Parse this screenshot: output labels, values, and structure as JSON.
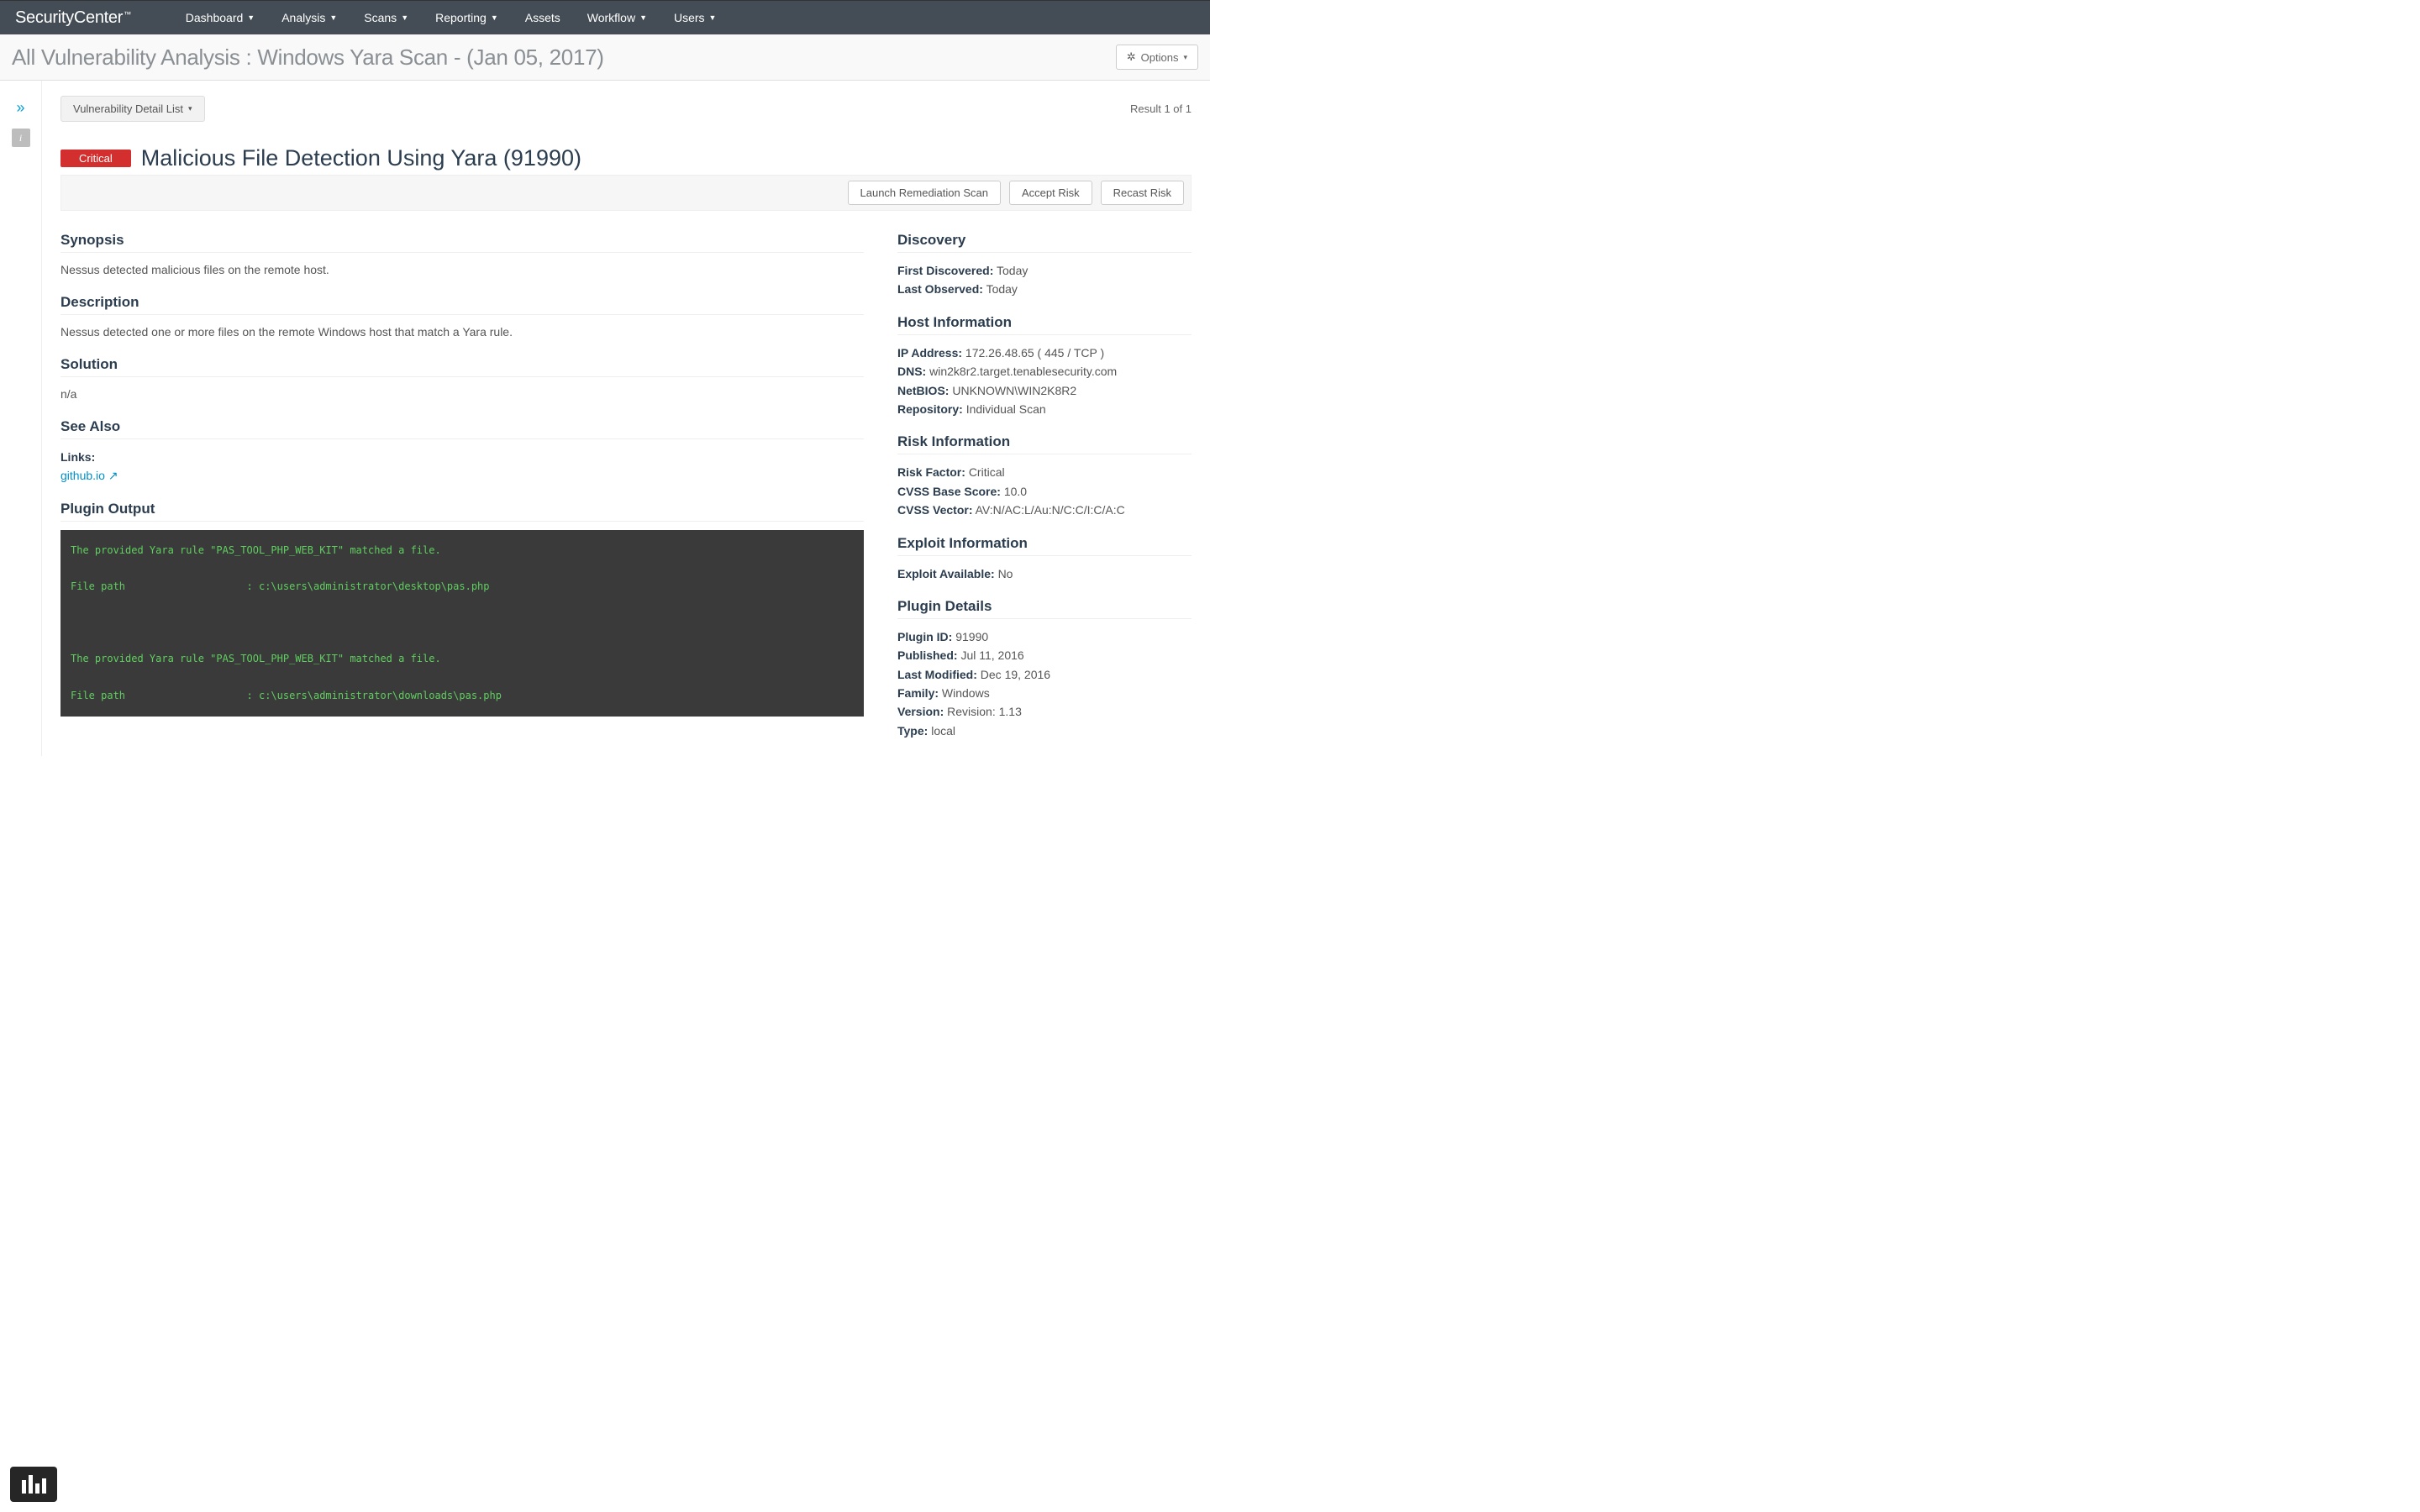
{
  "brand": "SecurityCenter",
  "nav": [
    "Dashboard",
    "Analysis",
    "Scans",
    "Reporting",
    "Assets",
    "Workflow",
    "Users"
  ],
  "nav_no_caret": [
    "Assets"
  ],
  "page_title": "All Vulnerability Analysis : Windows Yara Scan - (Jan 05, 2017)",
  "options_label": "Options",
  "view_selector": "Vulnerability Detail List",
  "result_count": "Result 1 of 1",
  "severity": "Critical",
  "vuln_title": "Malicious File Detection Using Yara (91990)",
  "actions": {
    "launch": "Launch Remediation Scan",
    "accept": "Accept Risk",
    "recast": "Recast Risk"
  },
  "left": {
    "synopsis_h": "Synopsis",
    "synopsis": "Nessus detected malicious files on the remote host.",
    "description_h": "Description",
    "description": "Nessus detected one or more files on the remote Windows host that match a Yara rule.",
    "solution_h": "Solution",
    "solution": "n/a",
    "seealso_h": "See Also",
    "links_label": "Links:",
    "link_text": "github.io",
    "plugin_output_h": "Plugin Output",
    "plugin_output": "The provided Yara rule \"PAS_TOOL_PHP_WEB_KIT\" matched a file.\n\nFile path                    : c:\\users\\administrator\\desktop\\pas.php\n\n\n\nThe provided Yara rule \"PAS_TOOL_PHP_WEB_KIT\" matched a file.\n\nFile path                    : c:\\users\\administrator\\downloads\\pas.php"
  },
  "right": {
    "discovery_h": "Discovery",
    "discovery": {
      "first_label": "First Discovered:",
      "first_val": "Today",
      "last_label": "Last Observed:",
      "last_val": "Today"
    },
    "host_h": "Host Information",
    "host": {
      "ip_label": "IP Address:",
      "ip_val": "172.26.48.65 ( 445 / TCP )",
      "dns_label": "DNS:",
      "dns_val": "win2k8r2.target.tenablesecurity.com",
      "netbios_label": "NetBIOS:",
      "netbios_val": "UNKNOWN\\WIN2K8R2",
      "repo_label": "Repository:",
      "repo_val": "Individual Scan"
    },
    "risk_h": "Risk Information",
    "risk": {
      "factor_label": "Risk Factor:",
      "factor_val": "Critical",
      "cvss_base_label": "CVSS Base Score:",
      "cvss_base_val": "10.0",
      "cvss_vector_label": "CVSS Vector:",
      "cvss_vector_val": "AV:N/AC:L/Au:N/C:C/I:C/A:C"
    },
    "exploit_h": "Exploit Information",
    "exploit": {
      "avail_label": "Exploit Available:",
      "avail_val": "No"
    },
    "plugin_h": "Plugin Details",
    "plugin": {
      "id_label": "Plugin ID:",
      "id_val": "91990",
      "pub_label": "Published:",
      "pub_val": "Jul 11, 2016",
      "mod_label": "Last Modified:",
      "mod_val": "Dec 19, 2016",
      "fam_label": "Family:",
      "fam_val": "Windows",
      "ver_label": "Version:",
      "ver_val": "Revision: 1.13",
      "type_label": "Type:",
      "type_val": "local"
    }
  }
}
